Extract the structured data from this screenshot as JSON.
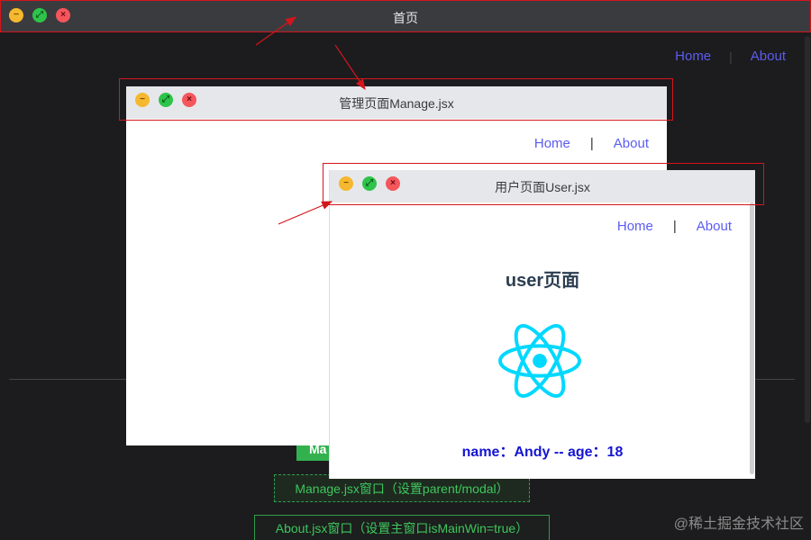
{
  "main": {
    "title": "首页",
    "nav": {
      "home": "Home",
      "about": "About"
    },
    "buttons": {
      "hidden_label": "Ma",
      "manage": "Manage.jsx窗口（设置parent/modal）",
      "about": "About.jsx窗口（设置主窗口isMainWin=true）"
    }
  },
  "manage_window": {
    "title": "管理页面Manage.jsx",
    "nav": {
      "home": "Home",
      "separator": "|",
      "about": "About"
    }
  },
  "user_window": {
    "title": "用户页面User.jsx",
    "nav": {
      "home": "Home",
      "separator": "|",
      "about": "About"
    },
    "heading": "user页面",
    "info": "name：Andy -- age：18",
    "logo_icon": "react-logo-icon"
  },
  "watermark": "@稀土掘金技术社区",
  "colors": {
    "highlight": "#d3151b",
    "link": "#5b5cf0",
    "react": "#00d8ff",
    "button_green": "#3ec65e"
  }
}
